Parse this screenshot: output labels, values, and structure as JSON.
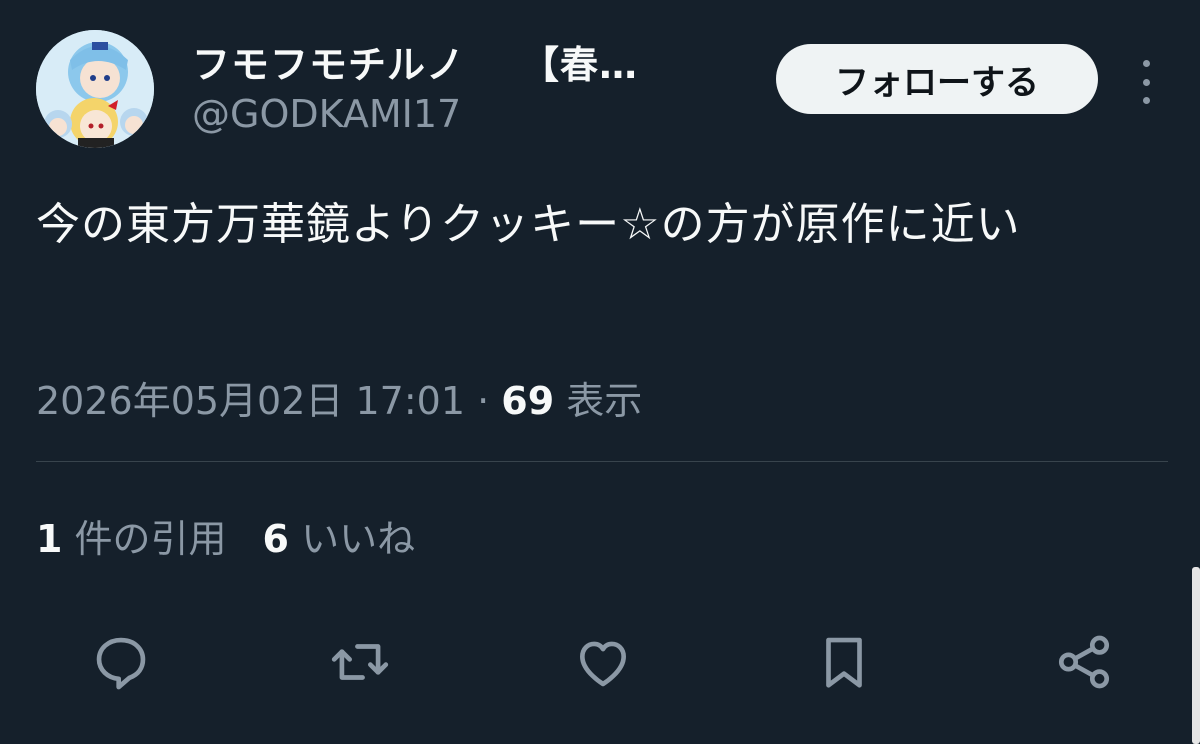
{
  "user": {
    "display_name": "フモフモチルノ",
    "display_name_suffix": "【春…",
    "handle": "@GODKAMI17"
  },
  "follow_button": {
    "label": "フォローする"
  },
  "tweet": {
    "text": "今の東方万華鏡よりクッキー☆の方が原作に近い"
  },
  "meta": {
    "timestamp": "2026年05月02日 17:01",
    "separator": " · ",
    "views_count": "69",
    "views_label": " 表示"
  },
  "stats": {
    "quotes_count": "1",
    "quotes_label": " 件の引用",
    "likes_count": "6",
    "likes_label": " いいね"
  },
  "actions": [
    {
      "icon": "reply-icon"
    },
    {
      "icon": "retweet-icon"
    },
    {
      "icon": "like-icon"
    },
    {
      "icon": "bookmark-icon"
    },
    {
      "icon": "share-icon"
    }
  ],
  "colors": {
    "background": "#15202b",
    "primary_text": "#f7f9f9",
    "secondary_text": "#8b98a5",
    "divider": "#38444d",
    "follow_button_bg": "#eff3f4",
    "follow_button_text": "#0f1419"
  }
}
